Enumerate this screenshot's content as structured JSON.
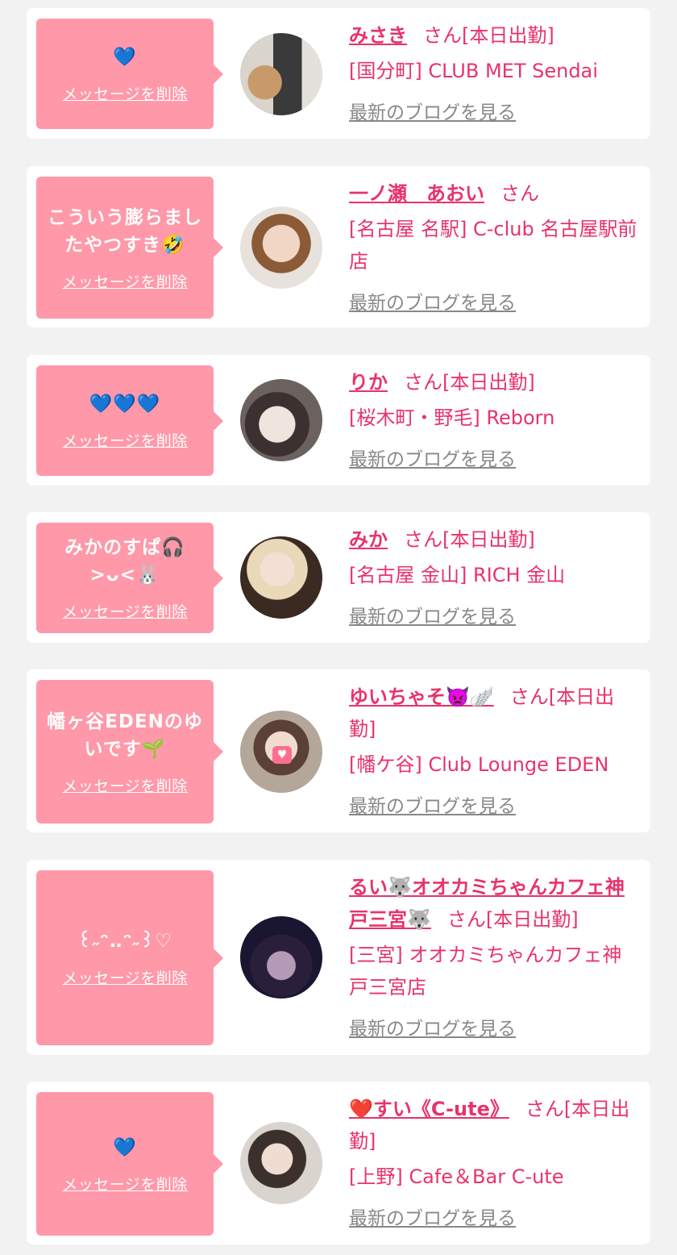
{
  "cards": [
    {
      "message": "💙",
      "delete_label": "メッセージを削除",
      "name": "みさき",
      "suffix": "さん[本日出勤]",
      "shop": "[国分町] CLUB MET Sendai",
      "blog_label": "最新のブログを見る",
      "avatar_icon": "profile-photo"
    },
    {
      "message": "こういう膨らましたやつすき🤣",
      "delete_label": "メッセージを削除",
      "name": "一ノ瀬　あおい",
      "suffix": "さん",
      "shop": "[名古屋 名駅] C-club 名古屋駅前店",
      "blog_label": "最新のブログを見る",
      "avatar_icon": "profile-photo"
    },
    {
      "message": "💙💙💙",
      "delete_label": "メッセージを削除",
      "name": "りか",
      "suffix": "さん[本日出勤]",
      "shop": "[桜木町・野毛] Reborn",
      "blog_label": "最新のブログを見る",
      "avatar_icon": "profile-photo"
    },
    {
      "message": "みかのすぱ🎧>ᴗ<🐰",
      "delete_label": "メッセージを削除",
      "name": "みか",
      "suffix": "さん[本日出勤]",
      "shop": "[名古屋 金山] RICH 金山",
      "blog_label": "最新のブログを見る",
      "avatar_icon": "profile-photo"
    },
    {
      "message": "幡ヶ谷EDENのゆいです🌱",
      "delete_label": "メッセージを削除",
      "name": "ゆいちゃそ👿🪽",
      "suffix": "さん[本日出勤]",
      "shop": "[幡ケ谷] Club Lounge EDEN",
      "blog_label": "最新のブログを見る",
      "avatar_icon": "profile-photo"
    },
    {
      "message": "꒰˶ᵔ‥ᵔ˶꒱♡",
      "delete_label": "メッセージを削除",
      "name": "るい🐺オオカミちゃんカフェ神戸三宮🐺",
      "suffix": "さん[本日出勤]",
      "shop": "[三宮] オオカミちゃんカフェ神戸三宮店",
      "blog_label": "最新のブログを見る",
      "avatar_icon": "profile-photo"
    },
    {
      "message": "💙",
      "delete_label": "メッセージを削除",
      "name": "❤️すい《C-ute》",
      "suffix": "さん[本日出勤]",
      "shop": "[上野] Cafe＆Bar C-ute",
      "blog_label": "最新のブログを見る",
      "avatar_icon": "profile-photo"
    }
  ],
  "colors": {
    "page_bg": "#f2f2f2",
    "bubble": "#ff98a8",
    "accent": "#e8336a",
    "link_gray": "#888888"
  }
}
